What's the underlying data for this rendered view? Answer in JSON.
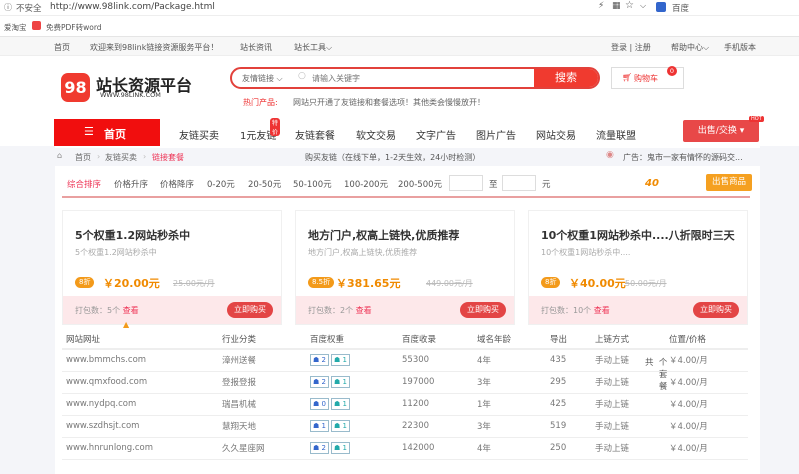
{
  "browser": {
    "security": "不安全",
    "url": "http://www.98link.com/Package.html",
    "search_engine": "百度",
    "bookmarks": [
      "爱淘宝",
      "免费PDF转word"
    ]
  },
  "topnav": {
    "home": "首页",
    "welcome": "欢迎来到98link链接资源服务平台！",
    "news": "站长资讯",
    "tools": "站长工具",
    "login": "登录 | 注册",
    "help": "帮助中心",
    "mobile": "手机版本"
  },
  "header": {
    "logo_text": "站长资源平台",
    "logo_sub": "WWW.98LINK.COM",
    "logo_num": "98",
    "search_category": "友情链接",
    "search_placeholder": "请输入关键字",
    "search_button": "搜索",
    "cart": "购物车",
    "cart_count": "0",
    "hot_label": "热门产品:",
    "hot_text": "网站只开通了友链接和套餐选项！其他类会慢慢放开！"
  },
  "nav": {
    "home": "首页",
    "items": [
      "友链买卖",
      "1元友链",
      "友链套餐",
      "软文交易",
      "文字广告",
      "图片广告",
      "网站交易",
      "流量联盟"
    ],
    "badge": "特价",
    "sell": "出售/交换",
    "hot": "HOT"
  },
  "breadcrumb": {
    "items": [
      "首页",
      "友链买卖",
      "链接套餐"
    ],
    "notice": "购买友链（在线下单，1-2天生效，24小时检测）",
    "ad": "广告：鬼市一家有情怀的源码交..."
  },
  "filters": {
    "items": [
      "综合排序",
      "价格升序",
      "价格降序",
      "0-20元",
      "20-50元",
      "50-100元",
      "100-200元",
      "200-500元"
    ],
    "to": "至",
    "unit": "元",
    "total_prefix": "共",
    "total": "40",
    "total_suffix": "个套餐",
    "sell_button": "出售商品"
  },
  "cards": [
    {
      "title": "5个权重1.2网站秒杀中",
      "subtitle": "5个权重1.2网站秒杀中",
      "discount": "8折",
      "price": "￥20.00元",
      "old_price": "25.00元/月",
      "count": "打包数：5个",
      "view": "查看",
      "buy": "立即购买"
    },
    {
      "title": "地方门户,权高上链快,优质推荐",
      "subtitle": "地方门户,权高上链快,优质推荐",
      "discount": "8.5折",
      "price": "￥381.65元",
      "old_price": "449.00元/月",
      "count": "打包数：2个",
      "view": "查看",
      "buy": "立即购买"
    },
    {
      "title": "10个权重1网站秒杀中....八折限时三天",
      "subtitle": "10个权重1网站秒杀中....",
      "discount": "8折",
      "price": "￥40.00元",
      "old_price": "50.00元/月",
      "count": "打包数：10个",
      "view": "查看",
      "buy": "立即购买"
    }
  ],
  "table": {
    "headers": [
      "网站网址",
      "行业分类",
      "百度权重",
      "百度收录",
      "域名年龄",
      "导出",
      "上链方式",
      "位置/价格"
    ],
    "rows": [
      [
        "www.bmmchs.com",
        "漳州送餐",
        "2",
        "1",
        "55300",
        "4年",
        "435",
        "手动上链",
        "￥4.00/月"
      ],
      [
        "www.qmxfood.com",
        "登报登报",
        "2",
        "1",
        "197000",
        "3年",
        "295",
        "手动上链",
        "￥4.00/月"
      ],
      [
        "www.nydpq.com",
        "瑞昌机械",
        "0",
        "1",
        "11200",
        "1年",
        "425",
        "手动上链",
        "￥4.00/月"
      ],
      [
        "www.szdhsjt.com",
        "慧翔天地",
        "1",
        "1",
        "22300",
        "3年",
        "519",
        "手动上链",
        "￥4.00/月"
      ],
      [
        "www.hnrunlong.com",
        "久久星座网",
        "2",
        "1",
        "142000",
        "4年",
        "250",
        "手动上链",
        "￥4.00/月"
      ]
    ]
  }
}
